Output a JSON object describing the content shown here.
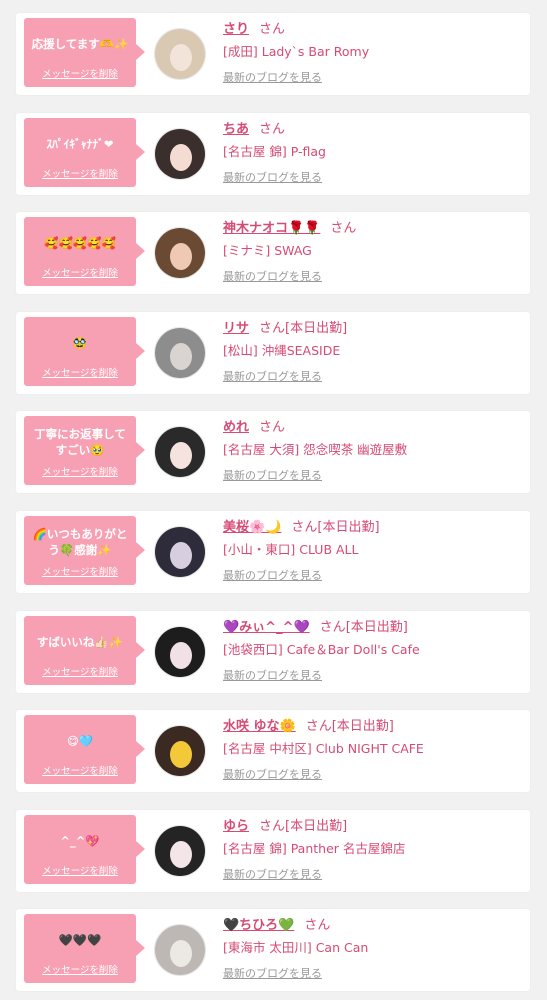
{
  "labels": {
    "delete": "メッセージを削除",
    "blog": "最新のブログを見る",
    "san": "さん"
  },
  "colors": {
    "accent": "#d64b74",
    "bubble": "#f8a0b3",
    "background": "#f1f1f1"
  },
  "items": [
    {
      "message": "応援してます🫶✨",
      "name": "さり",
      "status": "",
      "shop": "[成田] Lady`s Bar Romy",
      "avatar_colors": [
        "#d9c9b2",
        "#f2e4d8"
      ]
    },
    {
      "message": "ｽﾊﾟｲｷﾞｬﾅﾅﾞ❤",
      "name": "ちあ",
      "status": "",
      "shop": "[名古屋 錦] P-flag",
      "avatar_colors": [
        "#3a2f2c",
        "#f4dcd2"
      ]
    },
    {
      "message": "🥰🥰🥰🥰🥰",
      "name": "神木ナオコ🌹🌹",
      "status": "",
      "shop": "[ミナミ] SWAG",
      "avatar_colors": [
        "#6b4a34",
        "#efc9b3"
      ]
    },
    {
      "message": "🥸",
      "name": "リサ",
      "status": "[本日出勤]",
      "shop": "[松山] 沖縄SEASIDE",
      "avatar_colors": [
        "#8d8d8d",
        "#d9d4d0"
      ]
    },
    {
      "message": "丁寧にお返事してすごい🥹",
      "name": "めれ",
      "status": "",
      "shop": "[名古屋 大須] 怨念喫茶 幽遊屋敷",
      "avatar_colors": [
        "#2a2a2a",
        "#f6e2de"
      ]
    },
    {
      "message": "🌈いつもありがとう🍀感謝✨",
      "name": "美桜🌸🌙",
      "status": "[本日出勤]",
      "shop": "[小山・東口] CLUB ALL",
      "avatar_colors": [
        "#2e2b3a",
        "#d7cfe0"
      ]
    },
    {
      "message": "すばいいね👍🏻✨",
      "name": "💜みぃ^_^💜",
      "status": "[本日出勤]",
      "shop": "[池袋西口] Cafe＆Bar Doll's Cafe",
      "avatar_colors": [
        "#1d1d1d",
        "#f1e0e6"
      ]
    },
    {
      "message": "😋🩵",
      "name": "水咲 ゆな🌼",
      "status": "[本日出勤]",
      "shop": "[名古屋 中村区] Club NIGHT CAFE",
      "avatar_colors": [
        "#3b2a22",
        "#f3c93a"
      ]
    },
    {
      "message": "^_^💖",
      "name": "ゆら",
      "status": "[本日出勤]",
      "shop": "[名古屋 錦] Panther 名古屋錦店",
      "avatar_colors": [
        "#242424",
        "#f3e5e8"
      ]
    },
    {
      "message": "🖤🖤🖤",
      "name": "🖤ちひろ💚",
      "status": "",
      "shop": "[東海市 太田川] Can Can",
      "avatar_colors": [
        "#bdb8b4",
        "#ece8e4"
      ]
    }
  ]
}
